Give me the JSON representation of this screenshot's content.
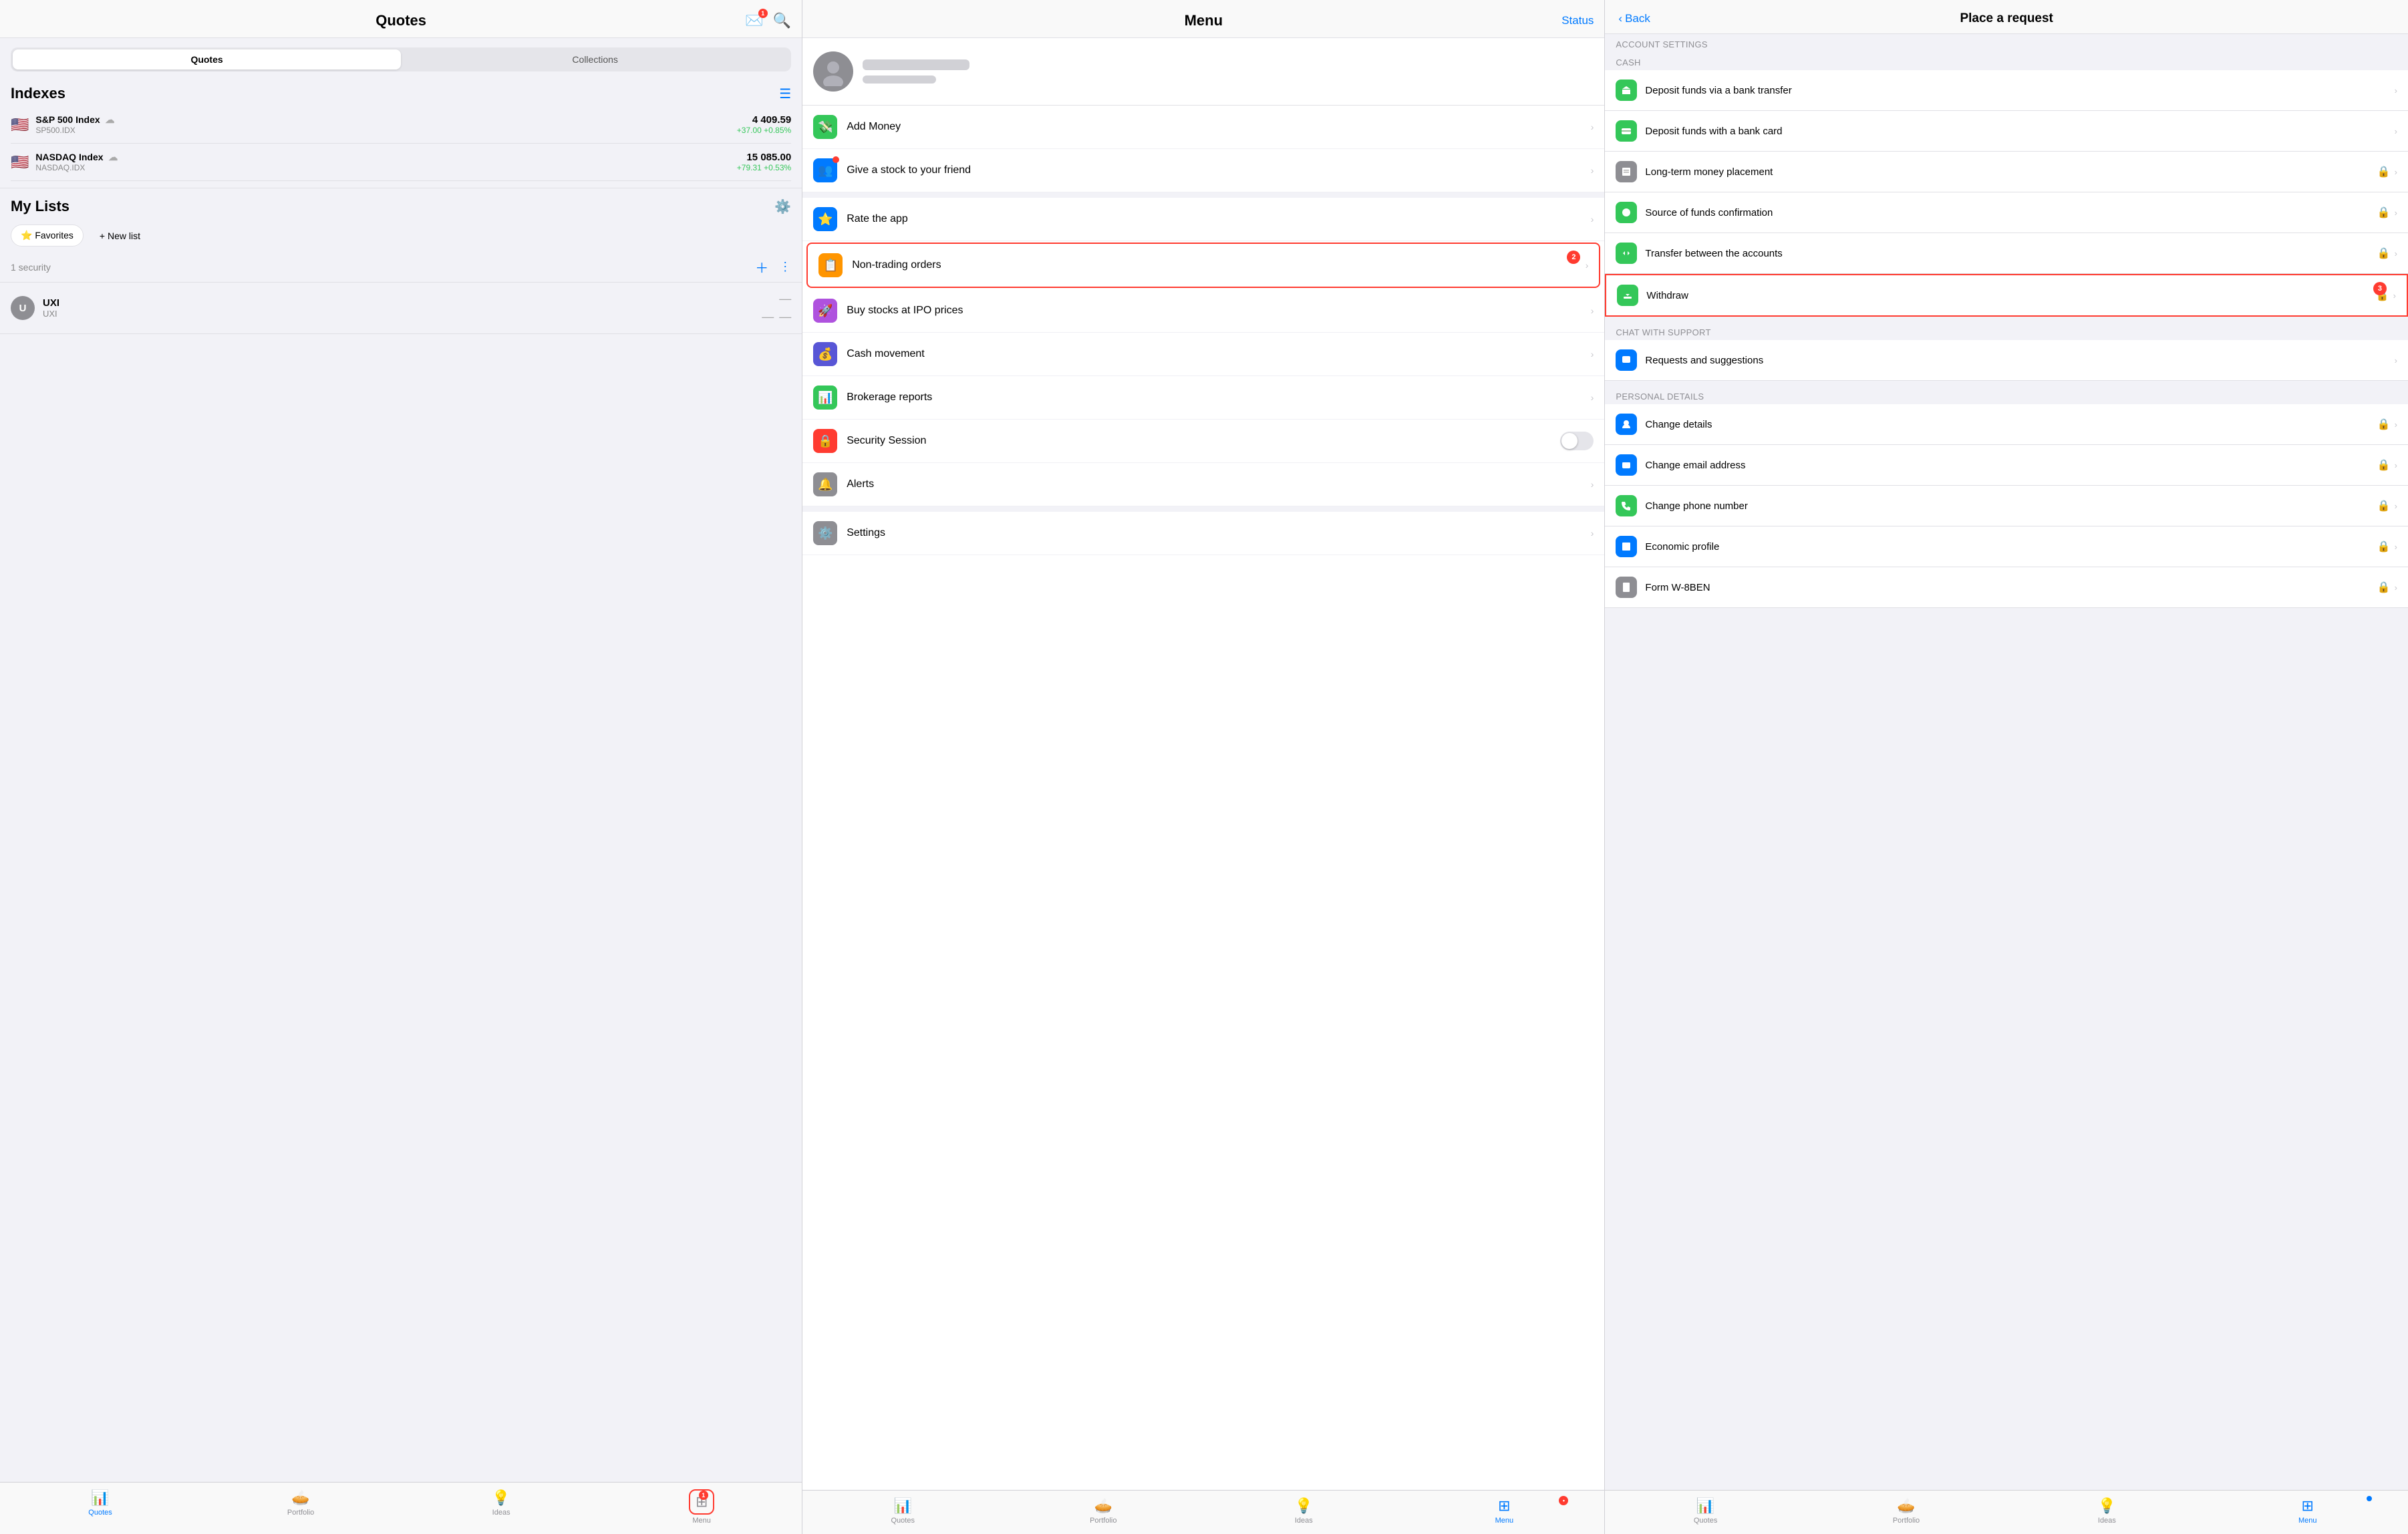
{
  "left": {
    "header": {
      "title": "Quotes"
    },
    "tabs": [
      {
        "label": "Quotes",
        "active": true
      },
      {
        "label": "Collections",
        "active": false
      }
    ],
    "indexes": {
      "title": "Indexes",
      "items": [
        {
          "flag": "🇺🇸",
          "name": "S&P 500 Index",
          "ticker": "SP500.IDX",
          "price": "4 409.59",
          "change": "+37.00  +0.85%"
        },
        {
          "flag": "🇺🇸",
          "name": "NASDAQ Index",
          "ticker": "NASDAQ.IDX",
          "price": "15 085.00",
          "change": "+79.31  +0.53%"
        }
      ]
    },
    "myLists": {
      "title": "My Lists",
      "favLabel": "⭐ Favorites",
      "newListLabel": "+ New list",
      "securityCount": "1 security",
      "stock": {
        "initial": "U",
        "name": "UXI",
        "ticker": "UXI"
      }
    },
    "tabBar": [
      {
        "icon": "📊",
        "label": "Quotes",
        "active": true
      },
      {
        "icon": "🥧",
        "label": "Portfolio",
        "active": false
      },
      {
        "icon": "💡",
        "label": "Ideas",
        "active": false
      },
      {
        "icon": "⊞",
        "label": "Menu",
        "active": false,
        "badge": "1"
      }
    ]
  },
  "mid": {
    "header": {
      "title": "Menu",
      "statusLabel": "Status"
    },
    "menuItems": [
      {
        "icon": "💸",
        "iconBg": "#34c759",
        "label": "Add Money",
        "hasChevron": true,
        "id": "add-money"
      },
      {
        "icon": "👥",
        "iconBg": "#007aff",
        "label": "Give a stock to your friend",
        "hasChevron": true,
        "id": "give-stock",
        "hasDot": true
      },
      {
        "icon": "⭐",
        "iconBg": "#007aff",
        "label": "Rate the app",
        "hasChevron": true,
        "id": "rate-app"
      },
      {
        "icon": "📋",
        "iconBg": "#ff9500",
        "label": "Non-trading orders",
        "hasChevron": true,
        "id": "non-trading",
        "highlighted": true,
        "badge": "2"
      },
      {
        "icon": "🚀",
        "iconBg": "#af52de",
        "label": "Buy stocks at IPO prices",
        "hasChevron": true,
        "id": "ipo"
      },
      {
        "icon": "💰",
        "iconBg": "#5856d6",
        "label": "Cash movement",
        "hasChevron": true,
        "id": "cash"
      },
      {
        "icon": "📊",
        "iconBg": "#34c759",
        "label": "Brokerage reports",
        "hasChevron": true,
        "id": "reports"
      },
      {
        "icon": "🔒",
        "iconBg": "#ff3b30",
        "label": "Security Session",
        "hasChevron": false,
        "hasToggle": true,
        "id": "security"
      },
      {
        "icon": "🔔",
        "iconBg": "#8e8e93",
        "label": "Alerts",
        "hasChevron": true,
        "id": "alerts"
      },
      {
        "icon": "⚙️",
        "iconBg": "#8e8e93",
        "label": "Settings",
        "hasChevron": true,
        "id": "settings"
      }
    ],
    "tabBar": [
      {
        "icon": "📊",
        "label": "Quotes",
        "active": false
      },
      {
        "icon": "🥧",
        "label": "Portfolio",
        "active": false
      },
      {
        "icon": "💡",
        "label": "Ideas",
        "active": false
      },
      {
        "icon": "⊞",
        "label": "Menu",
        "active": true
      }
    ]
  },
  "right": {
    "header": {
      "backLabel": "Back",
      "title": "Place a request"
    },
    "sections": [
      {
        "id": "account-settings",
        "header": "ACCOUNT SETTINGS",
        "items": []
      },
      {
        "id": "cash",
        "header": "CASH",
        "items": [
          {
            "icon": "⬆️",
            "iconBg": "#34c759",
            "label": "Deposit funds via a bank transfer",
            "locked": false
          },
          {
            "icon": "💳",
            "iconBg": "#34c759",
            "label": "Deposit funds with a bank card",
            "locked": false
          },
          {
            "icon": "📋",
            "iconBg": "#8e8e93",
            "label": "Long-term money placement",
            "locked": true
          },
          {
            "icon": "💵",
            "iconBg": "#34c759",
            "label": "Source of funds confirmation",
            "locked": true
          },
          {
            "icon": "↔️",
            "iconBg": "#34c759",
            "label": "Transfer between the accounts",
            "locked": true
          },
          {
            "icon": "📤",
            "iconBg": "#34c759",
            "label": "Withdraw",
            "locked": true,
            "highlighted": true,
            "badge": "3"
          }
        ]
      },
      {
        "id": "chat-support",
        "header": "CHAT WITH SUPPORT",
        "items": [
          {
            "icon": "📝",
            "iconBg": "#007aff",
            "label": "Requests and suggestions",
            "locked": false
          }
        ]
      },
      {
        "id": "personal-details",
        "header": "PERSONAL DETAILS",
        "items": [
          {
            "icon": "👤",
            "iconBg": "#007aff",
            "label": "Change details",
            "locked": true
          },
          {
            "icon": "@",
            "iconBg": "#007aff",
            "label": "Change email address",
            "locked": true
          },
          {
            "icon": "📞",
            "iconBg": "#34c759",
            "label": "Change phone number",
            "locked": true
          },
          {
            "icon": "📋",
            "iconBg": "#007aff",
            "label": "Economic profile",
            "locked": true
          },
          {
            "icon": "📄",
            "iconBg": "#8e8e93",
            "label": "Form W-8BEN",
            "locked": true
          }
        ]
      }
    ],
    "tabBar": [
      {
        "icon": "📊",
        "label": "Quotes",
        "active": false
      },
      {
        "icon": "🥧",
        "label": "Portfolio",
        "active": false
      },
      {
        "icon": "💡",
        "label": "Ideas",
        "active": false
      },
      {
        "icon": "⊞",
        "label": "Menu",
        "active": true
      }
    ]
  }
}
